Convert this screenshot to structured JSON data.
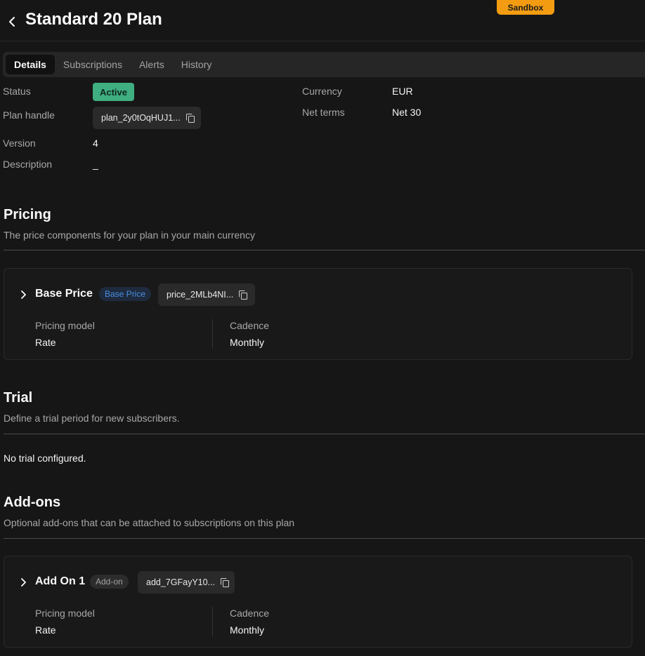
{
  "environment_badge": "Sandbox",
  "header": {
    "title": "Standard 20 Plan"
  },
  "tabs": [
    {
      "label": "Details"
    },
    {
      "label": "Subscriptions"
    },
    {
      "label": "Alerts"
    },
    {
      "label": "History"
    }
  ],
  "details": {
    "status_label": "Status",
    "status_value": "Active",
    "plan_handle_label": "Plan handle",
    "plan_handle_value": "plan_2y0tOqHUJ1...",
    "version_label": "Version",
    "version_value": "4",
    "description_label": "Description",
    "description_value": "_",
    "currency_label": "Currency",
    "currency_value": "EUR",
    "net_terms_label": "Net terms",
    "net_terms_value": "Net 30"
  },
  "pricing": {
    "title": "Pricing",
    "subtitle": "The price components for your plan in your main currency",
    "items": [
      {
        "name": "Base Price",
        "badge": "Base Price",
        "handle": "price_2MLb4NI...",
        "model_label": "Pricing model",
        "model_value": "Rate",
        "cadence_label": "Cadence",
        "cadence_value": "Monthly"
      }
    ]
  },
  "trial": {
    "title": "Trial",
    "subtitle": "Define a trial period for new subscribers.",
    "empty_text": "No trial configured."
  },
  "addons": {
    "title": "Add-ons",
    "subtitle": "Optional add-ons that can be attached to subscriptions on this plan",
    "items": [
      {
        "name": "Add On 1",
        "badge": "Add-on",
        "handle": "add_7GFayY10...",
        "model_label": "Pricing model",
        "model_value": "Rate",
        "cadence_label": "Cadence",
        "cadence_value": "Monthly"
      }
    ]
  },
  "colors": {
    "background": "#161616",
    "sandbox": "#f39c12",
    "active_badge": "#3fae80",
    "base_price_badge_text": "#4a90e2"
  }
}
